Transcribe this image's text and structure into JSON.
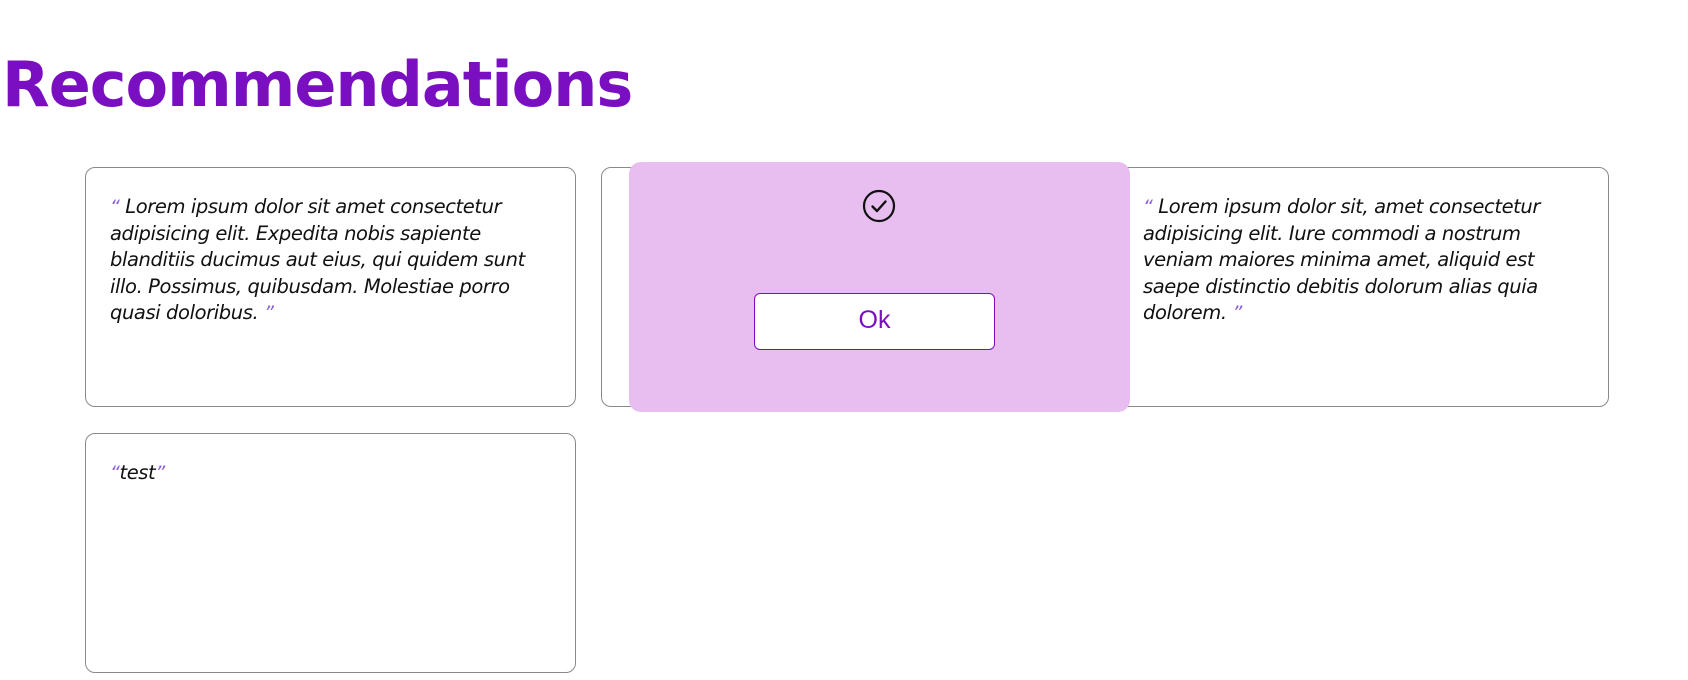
{
  "page": {
    "title": "Recommendations"
  },
  "quote_marks": {
    "open": "“",
    "close": "”"
  },
  "recommendations": [
    {
      "text": "Lorem ipsum dolor sit amet consectetur adipisicing elit. Expedita nobis sapiente blanditiis ducimus aut eius, qui quidem sunt illo. Possimus, quibusdam. Molestiae porro quasi doloribus."
    },
    {
      "text": ""
    },
    {
      "text": "Lorem ipsum dolor sit, amet consectetur adipisicing elit. Iure commodi a nostrum veniam maiores minima amet, aliquid est saepe distinctio debitis dolorum alias quia dolorem."
    },
    {
      "text": "test"
    }
  ],
  "dialog": {
    "icon": "check-circle-icon",
    "ok_label": "Ok"
  },
  "colors": {
    "accent": "#7a0fc2",
    "dialog_bg": "#e8bdf0",
    "quote_mark": "#8b5fd6"
  }
}
